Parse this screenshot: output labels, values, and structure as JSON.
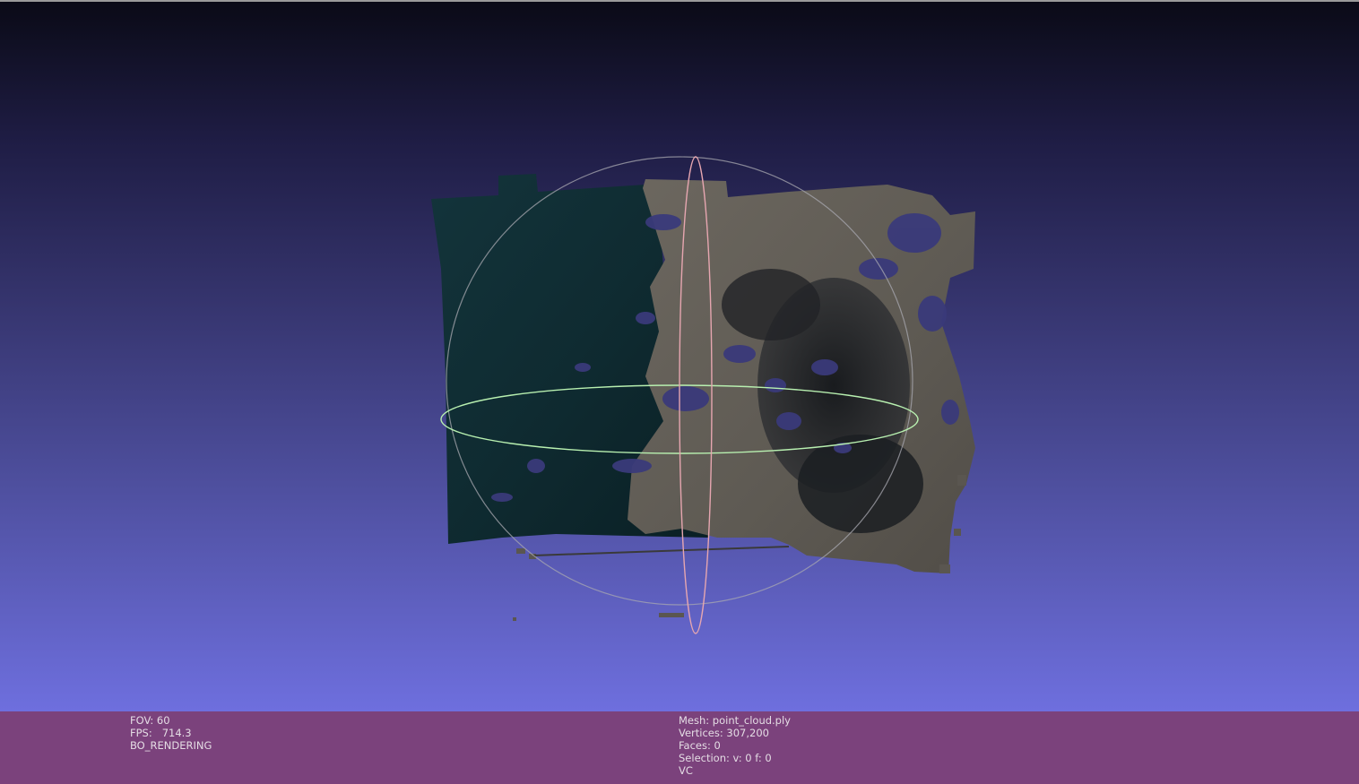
{
  "viewer": {
    "background_top": "#0a0a16",
    "background_bottom": "#6e6fde",
    "infobar_color": "#7b427c",
    "trackball_colors": {
      "vertical_ring": "#e6a6b0",
      "horizontal_ring": "#b8f0b0",
      "outer_ring": "#a8a8b0"
    }
  },
  "info_left": {
    "fov": "FOV: 60",
    "fps": "FPS:   714.3",
    "mode": "BO_RENDERING"
  },
  "info_right": {
    "mesh": "Mesh: point_cloud.ply",
    "vertices": "Vertices: 307,200",
    "faces": "Faces: 0",
    "selection": "Selection: v: 0 f: 0",
    "color_mode": "VC"
  }
}
